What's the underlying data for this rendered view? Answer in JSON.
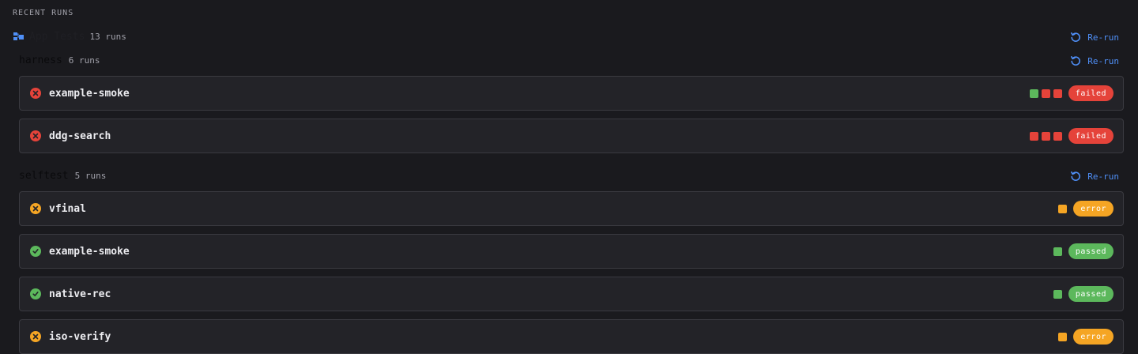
{
  "section": {
    "label": "RECENT RUNS"
  },
  "app": {
    "title": "App Tests",
    "count": "13 runs",
    "rerun_label": "Re-run"
  },
  "colors": {
    "failed": "#e5433a",
    "error": "#f5a524",
    "passed": "#5cb85c",
    "accent": "#4f8ff7"
  },
  "groups": [
    {
      "title": "harness",
      "count": "6 runs",
      "rerun_label": "Re-run",
      "runs": [
        {
          "name": "example-smoke",
          "status": "failed",
          "icon": "x-circle-icon",
          "history": [
            "passed",
            "failed",
            "failed"
          ]
        },
        {
          "name": "ddg-search",
          "status": "failed",
          "icon": "x-circle-icon",
          "history": [
            "failed",
            "failed",
            "failed"
          ]
        }
      ]
    },
    {
      "title": "selftest",
      "count": "5 runs",
      "rerun_label": "Re-run",
      "runs": [
        {
          "name": "vfinal",
          "status": "error",
          "icon": "x-circle-icon",
          "history": [
            "error"
          ]
        },
        {
          "name": "example-smoke",
          "status": "passed",
          "icon": "check-circle-icon",
          "history": [
            "passed"
          ]
        },
        {
          "name": "native-rec",
          "status": "passed",
          "icon": "check-circle-icon",
          "history": [
            "passed"
          ]
        },
        {
          "name": "iso-verify",
          "status": "error",
          "icon": "x-circle-icon",
          "history": [
            "error"
          ]
        }
      ]
    }
  ]
}
